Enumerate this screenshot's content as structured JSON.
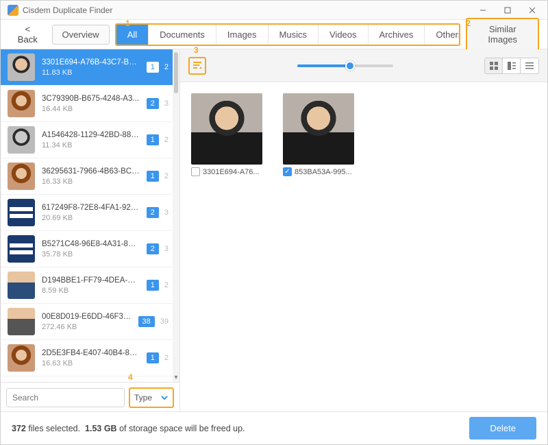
{
  "window": {
    "title": "Cisdem Duplicate Finder"
  },
  "callouts": {
    "one": "1",
    "two": "2",
    "three": "3",
    "four": "4"
  },
  "toolbar": {
    "back_label": "Back",
    "overview_label": "Overview",
    "similar_label": "Similar Images",
    "tabs": [
      "All",
      "Documents",
      "Images",
      "Musics",
      "Videos",
      "Archives",
      "Others"
    ],
    "active_tab": "All"
  },
  "sidebar": {
    "items": [
      {
        "name": "3301E694-A76B-43C7-B8...",
        "size": "11.83 KB",
        "b1": "1",
        "b2": "2",
        "selected": true,
        "thumb": "th-face"
      },
      {
        "name": "3C79390B-B675-4248-A3...",
        "size": "16.44 KB",
        "b1": "2",
        "b2": "3",
        "thumb": "th-woman"
      },
      {
        "name": "A1546428-1129-42BD-889...",
        "size": "11.34 KB",
        "b1": "1",
        "b2": "2",
        "thumb": "th-face th-gray"
      },
      {
        "name": "36295631-7966-4B63-BC9...",
        "size": "16.33 KB",
        "b1": "1",
        "b2": "2",
        "thumb": "th-woman"
      },
      {
        "name": "617249F8-72E8-4FA1-921...",
        "size": "20.69 KB",
        "b1": "2",
        "b2": "3",
        "thumb": "th-text"
      },
      {
        "name": "B5271C48-96E8-4A31-810...",
        "size": "35.78 KB",
        "b1": "2",
        "b2": "3",
        "thumb": "th-text"
      },
      {
        "name": "D194BBE1-FF79-4DEA-95...",
        "size": "8.59 KB",
        "b1": "1",
        "b2": "2",
        "thumb": "th-suit"
      },
      {
        "name": "00E8D019-E6DD-46F3-9E...",
        "size": "272.46 KB",
        "b1": "38",
        "b2": "39",
        "thumb": "th-suit2"
      },
      {
        "name": "2D5E3FB4-E407-40B4-815...",
        "size": "16.63 KB",
        "b1": "1",
        "b2": "2",
        "thumb": "th-woman"
      }
    ],
    "search_placeholder": "Search",
    "type_label": "Type"
  },
  "grid": {
    "items": [
      {
        "label": "3301E694-A76...",
        "checked": false
      },
      {
        "label": "853BA53A-995...",
        "checked": true
      }
    ]
  },
  "status": {
    "count": "372",
    "count_suffix": "files selected.",
    "size": "1.53 GB",
    "size_suffix": "of storage space will be freed up.",
    "delete_label": "Delete"
  }
}
